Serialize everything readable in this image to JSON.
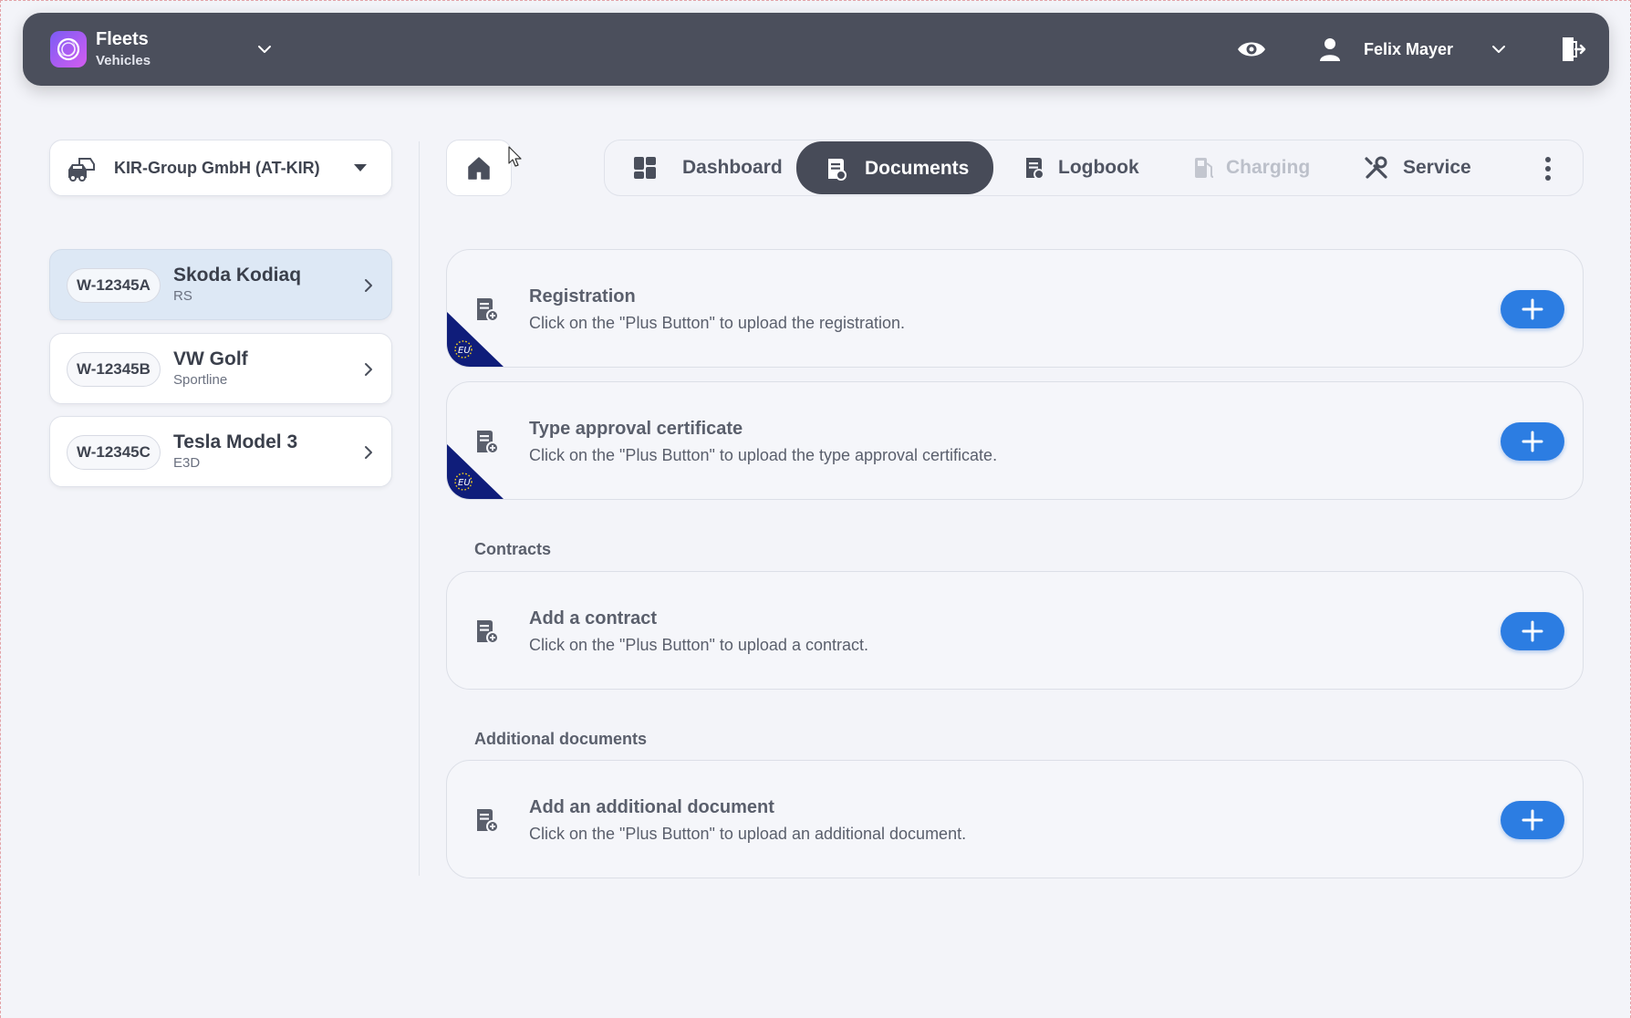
{
  "app": {
    "title": "Fleets",
    "subtitle": "Vehicles"
  },
  "header": {
    "user_name": "Felix Mayer"
  },
  "company": {
    "label": "KIR-Group GmbH (AT-KIR)"
  },
  "vehicles": [
    {
      "plate": "W-12345A",
      "name": "Skoda Kodiaq",
      "variant": "RS",
      "selected": true
    },
    {
      "plate": "W-12345B",
      "name": "VW Golf",
      "variant": "Sportline",
      "selected": false
    },
    {
      "plate": "W-12345C",
      "name": "Tesla Model 3",
      "variant": "E3D",
      "selected": false
    }
  ],
  "tabs": [
    {
      "label": "Dashboard",
      "state": "normal"
    },
    {
      "label": "Documents",
      "state": "active"
    },
    {
      "label": "Logbook",
      "state": "normal"
    },
    {
      "label": "Charging",
      "state": "disabled"
    },
    {
      "label": "Service",
      "state": "normal"
    }
  ],
  "documents": {
    "registration": {
      "title": "Registration",
      "desc": "Click on the \"Plus Button\" to upload the registration."
    },
    "type_approval": {
      "title": "Type approval certificate",
      "desc": "Click on the \"Plus Button\" to upload the type approval certificate."
    },
    "contracts_section": "Contracts",
    "contract": {
      "title": "Add a contract",
      "desc": "Click on the \"Plus Button\" to upload a contract."
    },
    "additional_section": "Additional documents",
    "additional": {
      "title": "Add an additional document",
      "desc": "Click on the \"Plus Button\" to upload an additional document."
    },
    "eu_badge_text": "EU"
  },
  "colors": {
    "topbar": "#4b4f5c",
    "accent_blue": "#2c7de2",
    "active_tab": "#474b58",
    "selected_vehicle": "#dde8f5",
    "eu_navy": "#0f1d7a"
  }
}
